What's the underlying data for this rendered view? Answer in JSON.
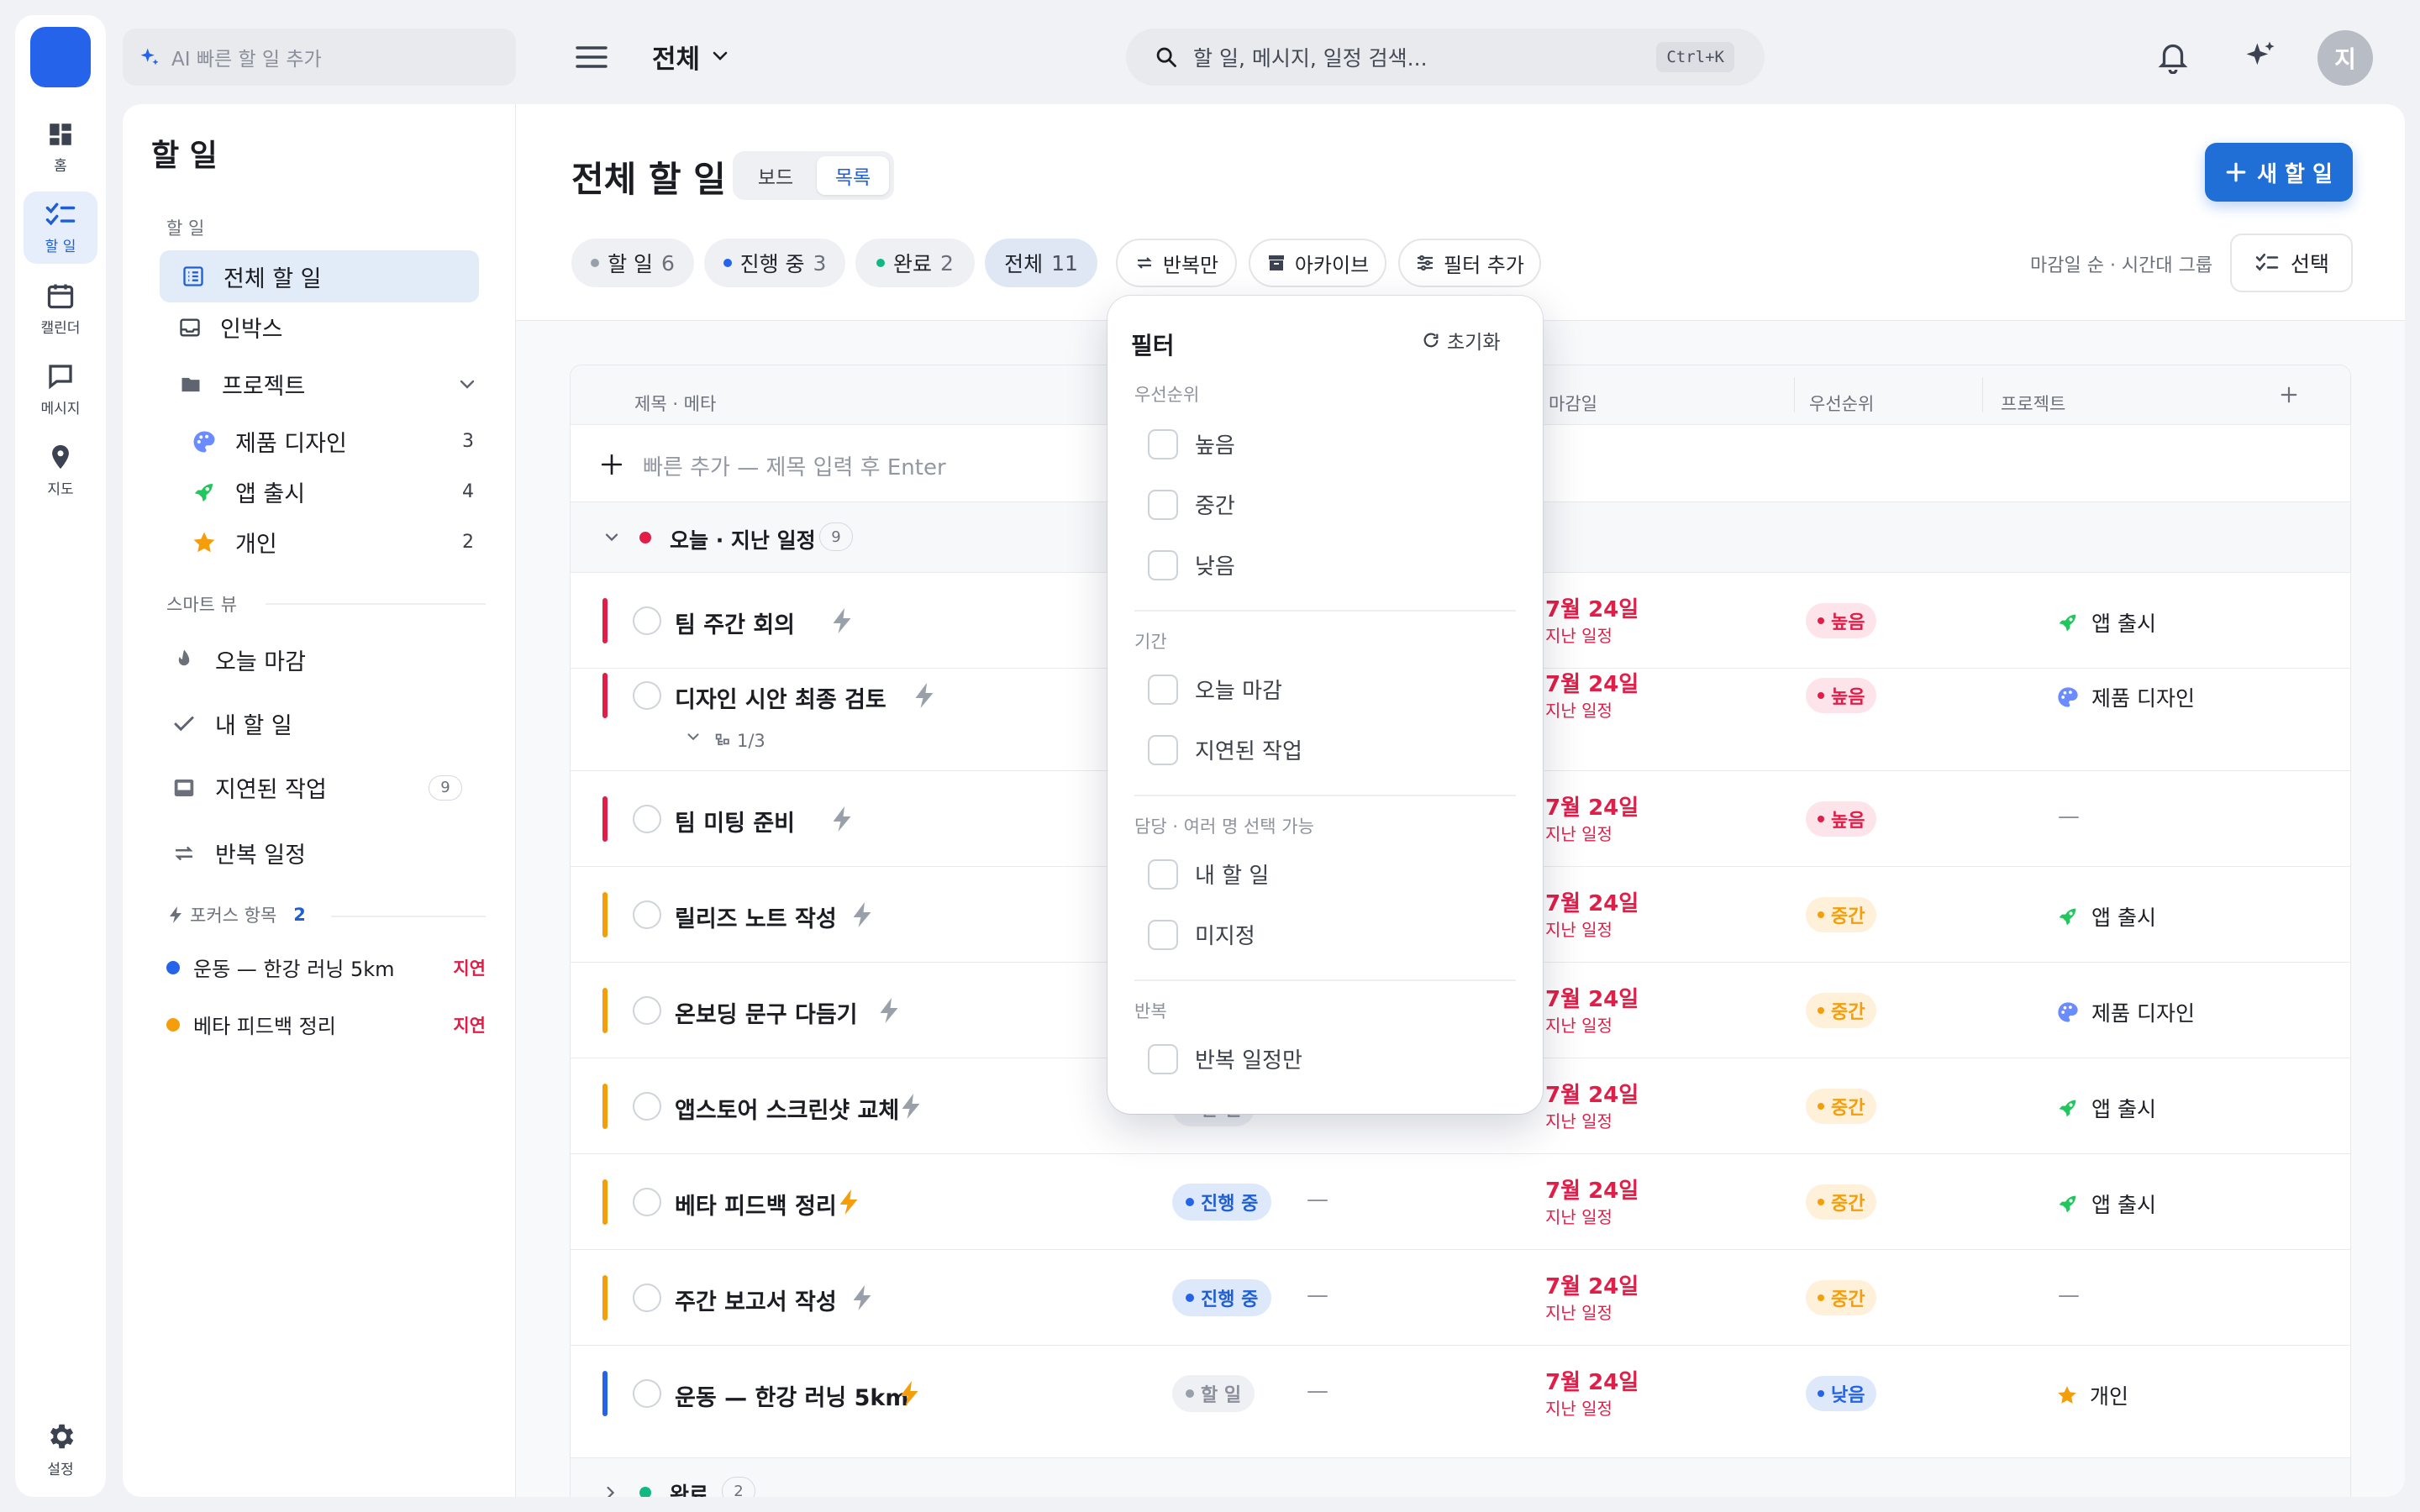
{
  "topbar": {
    "ai_placeholder": "AI 빠른 할 일 추가",
    "scope_label": "전체",
    "search_placeholder": "할 일, 메시지, 일정 검색...",
    "search_shortcut": "Ctrl+K",
    "avatar_initial": "지"
  },
  "rail": {
    "items": [
      {
        "label": "홈",
        "icon": "dashboard-icon"
      },
      {
        "label": "할 일",
        "icon": "checklist-icon"
      },
      {
        "label": "캘린더",
        "icon": "calendar-icon"
      },
      {
        "label": "메시지",
        "icon": "message-icon"
      },
      {
        "label": "지도",
        "icon": "map-pin-icon"
      }
    ],
    "settings_label": "설정"
  },
  "sidebar": {
    "title": "할 일",
    "section_todo": "할 일",
    "all_todos": "전체 할 일",
    "inbox": "인박스",
    "projects": "프로젝트",
    "project_items": [
      {
        "label": "제품 디자인",
        "count": "3",
        "icon": "palette-icon"
      },
      {
        "label": "앱 출시",
        "count": "4",
        "icon": "rocket-icon"
      },
      {
        "label": "개인",
        "count": "2",
        "icon": "star-icon"
      }
    ],
    "smart_view_header": "스마트 뷰",
    "smart_items": [
      {
        "label": "오늘 마감",
        "icon": "fire-icon"
      },
      {
        "label": "내 할 일",
        "icon": "check-icon"
      },
      {
        "label": "지연된 작업",
        "icon": "tray-icon",
        "count": "9"
      },
      {
        "label": "반복 일정",
        "icon": "repeat-icon"
      }
    ],
    "focus_header": "포커스 항목",
    "focus_count": "2",
    "focus_items": [
      {
        "label": "운동 — 한강 러닝 5km",
        "badge": "지연",
        "color": "#2563eb"
      },
      {
        "label": "베타 피드백 정리",
        "badge": "지연",
        "color": "#f59e0b"
      }
    ]
  },
  "main": {
    "title": "전체 할 일",
    "view_board": "보드",
    "view_list": "목록",
    "new_task_label": "새 할 일",
    "filters": {
      "todo": {
        "label": "할 일",
        "count": "6"
      },
      "progress": {
        "label": "진행 중",
        "count": "3"
      },
      "done": {
        "label": "완료",
        "count": "2"
      },
      "all": {
        "label": "전체",
        "count": "11"
      }
    },
    "repeat_only": "반복만",
    "archive": "아카이브",
    "add_filter": "필터 추가",
    "sort_label": "마감일 순 · 시간대 그룹",
    "select_label": "선택"
  },
  "table": {
    "col_title": "제목 · 메타",
    "col_due": "마감일",
    "col_priority": "우선순위",
    "col_project": "프로젝트",
    "quick_add_placeholder": "빠른 추가 — 제목 입력 후 Enter",
    "group_today": {
      "label": "오늘 · 지난 일정",
      "count": "9"
    },
    "group_done": {
      "label": "완료",
      "count": "2"
    },
    "subtask_progress": "1/3",
    "rows": [
      {
        "title": "팀 주간 회의",
        "due": "7월 24일",
        "due_sub": "지난 일정",
        "priority": "높음",
        "project": "앱 출시",
        "project_icon": "rocket-icon",
        "bar": "#e11d48",
        "bolt": "#9aa0aa"
      },
      {
        "title": "디자인 시안 최종 검토",
        "due": "7월 24일",
        "due_sub": "지난 일정",
        "priority": "높음",
        "project": "제품 디자인",
        "project_icon": "palette-icon",
        "bar": "#e11d48",
        "bolt": "#9aa0aa"
      },
      {
        "title": "팀 미팅 준비",
        "due": "7월 24일",
        "due_sub": "지난 일정",
        "priority": "높음",
        "project": "—",
        "bar": "#e11d48",
        "bolt": "#9aa0aa"
      },
      {
        "title": "릴리즈 노트 작성",
        "due": "7월 24일",
        "due_sub": "지난 일정",
        "priority": "중간",
        "project": "앱 출시",
        "project_icon": "rocket-icon",
        "bar": "#f59e0b",
        "bolt": "#9aa0aa"
      },
      {
        "title": "온보딩 문구 다듬기",
        "due": "7월 24일",
        "due_sub": "지난 일정",
        "priority": "중간",
        "project": "제품 디자인",
        "project_icon": "palette-icon",
        "bar": "#f59e0b",
        "bolt": "#9aa0aa"
      },
      {
        "title": "앱스토어 스크린샷 교체",
        "due": "7월 24일",
        "due_sub": "지난 일정",
        "priority": "중간",
        "project": "앱 출시",
        "project_icon": "rocket-icon",
        "bar": "#f59e0b",
        "bolt": "#9aa0aa"
      },
      {
        "title": "베타 피드백 정리",
        "status": "진행 중",
        "due": "7월 24일",
        "due_sub": "지난 일정",
        "priority": "중간",
        "project": "앱 출시",
        "project_icon": "rocket-icon",
        "bar": "#f59e0b",
        "bolt": "#f59e0b"
      },
      {
        "title": "주간 보고서 작성",
        "status": "진행 중",
        "due": "7월 24일",
        "due_sub": "지난 일정",
        "priority": "중간",
        "project": "—",
        "bar": "#f59e0b",
        "bolt": "#9aa0aa"
      },
      {
        "title": "운동 — 한강 러닝 5km",
        "status": "할 일",
        "due": "7월 24일",
        "due_sub": "지난 일정",
        "priority": "낮음",
        "project": "개인",
        "project_icon": "star-icon",
        "bar": "#2563eb",
        "bolt": "#f59e0b"
      }
    ],
    "hidden_status_partial": "할 일"
  },
  "filter_popup": {
    "title": "필터",
    "reset": "초기화",
    "priority_header": "우선순위",
    "priority_options": [
      "높음",
      "중간",
      "낮음"
    ],
    "period_header": "기간",
    "period_options": [
      "오늘 마감",
      "지연된 작업"
    ],
    "assignee_header": "담당 · 여러 명 선택 가능",
    "assignee_options": [
      "내 할 일",
      "미지정"
    ],
    "repeat_header": "반복",
    "repeat_options": [
      "반복 일정만"
    ]
  },
  "colors": {
    "accent": "#1f6fd6",
    "danger": "#e11d48",
    "warning": "#f59e0b",
    "info": "#2563eb",
    "success": "#10b981"
  }
}
